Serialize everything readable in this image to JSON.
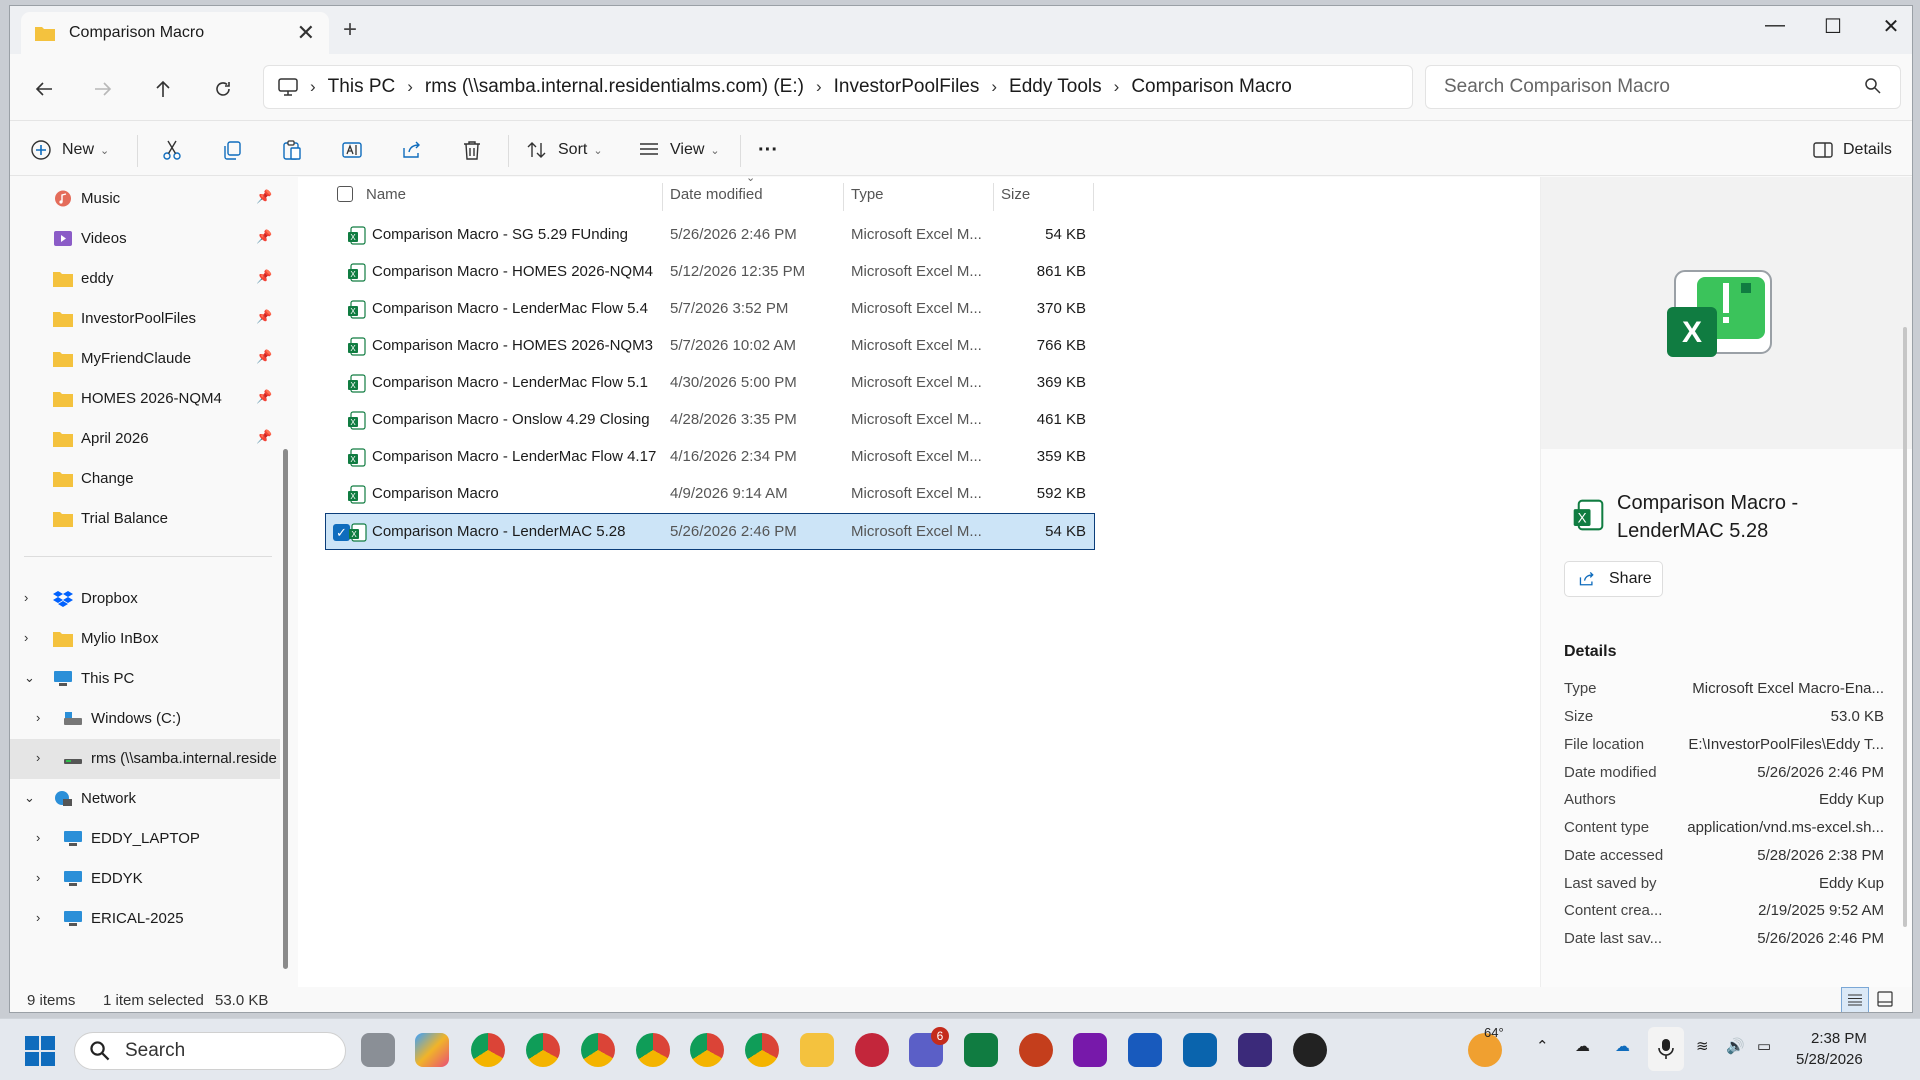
{
  "window": {
    "tab_title": "Comparison Macro",
    "tab_close": "✕",
    "new_tab": "+",
    "minimize": "—",
    "maximize": "☐",
    "close": "✕"
  },
  "breadcrumb": [
    "This PC",
    "rms (\\\\samba.internal.residentialms.com) (E:)",
    "InvestorPoolFiles",
    "Eddy Tools",
    "Comparison Macro"
  ],
  "search": {
    "placeholder": "Search Comparison Macro"
  },
  "toolbar": {
    "new_label": "New",
    "sort_label": "Sort",
    "view_label": "View",
    "more_label": "···",
    "details_label": "Details"
  },
  "nav": {
    "quick": [
      {
        "label": "Music",
        "icon": "music-icon"
      },
      {
        "label": "Videos",
        "icon": "videos-icon"
      },
      {
        "label": "eddy",
        "icon": "folder-icon"
      },
      {
        "label": "InvestorPoolFiles",
        "icon": "folder-icon"
      },
      {
        "label": "MyFriendClaude",
        "icon": "folder-icon"
      },
      {
        "label": "HOMES 2026-NQM4",
        "icon": "folder-icon"
      },
      {
        "label": "April 2026",
        "icon": "folder-icon"
      },
      {
        "label": "Change",
        "icon": "folder-icon"
      },
      {
        "label": "Trial Balance",
        "icon": "folder-icon"
      }
    ],
    "dropbox": "Dropbox",
    "mylio": "Mylio InBox",
    "thispc": "This PC",
    "windows": "Windows (C:)",
    "rms": "rms (\\\\samba.internal.reside",
    "network": "Network",
    "laptop": "EDDY_LAPTOP",
    "eddyk": "EDDYK",
    "erical": "ERICAL-2025"
  },
  "columns": {
    "name": "Name",
    "date": "Date modified",
    "type": "Type",
    "size": "Size"
  },
  "files": [
    {
      "name": "Comparison Macro - SG 5.29 FUnding",
      "date": "5/26/2026 2:46 PM",
      "type": "Microsoft Excel M...",
      "size": "54 KB"
    },
    {
      "name": "Comparison Macro - HOMES 2026-NQM4",
      "date": "5/12/2026 12:35 PM",
      "type": "Microsoft Excel M...",
      "size": "861 KB"
    },
    {
      "name": "Comparison Macro - LenderMac Flow 5.4",
      "date": "5/7/2026 3:52 PM",
      "type": "Microsoft Excel M...",
      "size": "370 KB"
    },
    {
      "name": "Comparison Macro - HOMES 2026-NQM3",
      "date": "5/7/2026 10:02 AM",
      "type": "Microsoft Excel M...",
      "size": "766 KB"
    },
    {
      "name": "Comparison Macro - LenderMac Flow 5.1",
      "date": "4/30/2026 5:00 PM",
      "type": "Microsoft Excel M...",
      "size": "369 KB"
    },
    {
      "name": "Comparison Macro - Onslow 4.29 Closing",
      "date": "4/28/2026 3:35 PM",
      "type": "Microsoft Excel M...",
      "size": "461 KB"
    },
    {
      "name": "Comparison Macro - LenderMac Flow 4.17",
      "date": "4/16/2026 2:34 PM",
      "type": "Microsoft Excel M...",
      "size": "359 KB"
    },
    {
      "name": "Comparison Macro",
      "date": "4/9/2026 9:14 AM",
      "type": "Microsoft Excel M...",
      "size": "592 KB"
    },
    {
      "name": "Comparison Macro - LenderMAC 5.28",
      "date": "5/26/2026 2:46 PM",
      "type": "Microsoft Excel M...",
      "size": "54 KB"
    }
  ],
  "details": {
    "title": "Comparison Macro - LenderMAC 5.28",
    "share": "Share",
    "heading": "Details",
    "props": [
      {
        "k": "Type",
        "v": "Microsoft Excel Macro-Ena..."
      },
      {
        "k": "Size",
        "v": "53.0 KB"
      },
      {
        "k": "File location",
        "v": "E:\\InvestorPoolFiles\\Eddy T..."
      },
      {
        "k": "Date modified",
        "v": "5/26/2026 2:46 PM"
      },
      {
        "k": "Authors",
        "v": "Eddy Kup"
      },
      {
        "k": "Content type",
        "v": "application/vnd.ms-excel.sh..."
      },
      {
        "k": "Date accessed",
        "v": "5/28/2026 2:38 PM"
      },
      {
        "k": "Last saved by",
        "v": "Eddy Kup"
      },
      {
        "k": "Content crea...",
        "v": "2/19/2025 9:52 AM"
      },
      {
        "k": "Date last sav...",
        "v": "5/26/2026 2:46 PM"
      }
    ]
  },
  "status": {
    "items": "9 items",
    "selected": "1 item selected",
    "size": "53.0 KB"
  },
  "taskbar": {
    "search": "Search",
    "teams_badge": "6",
    "weather": "64°",
    "time": "2:38 PM",
    "date": "5/28/2026"
  },
  "colors": {
    "accent": "#0f6cbd",
    "selection": "#cce4f7",
    "excel": "#107c41",
    "folder": "#f4c23e"
  }
}
